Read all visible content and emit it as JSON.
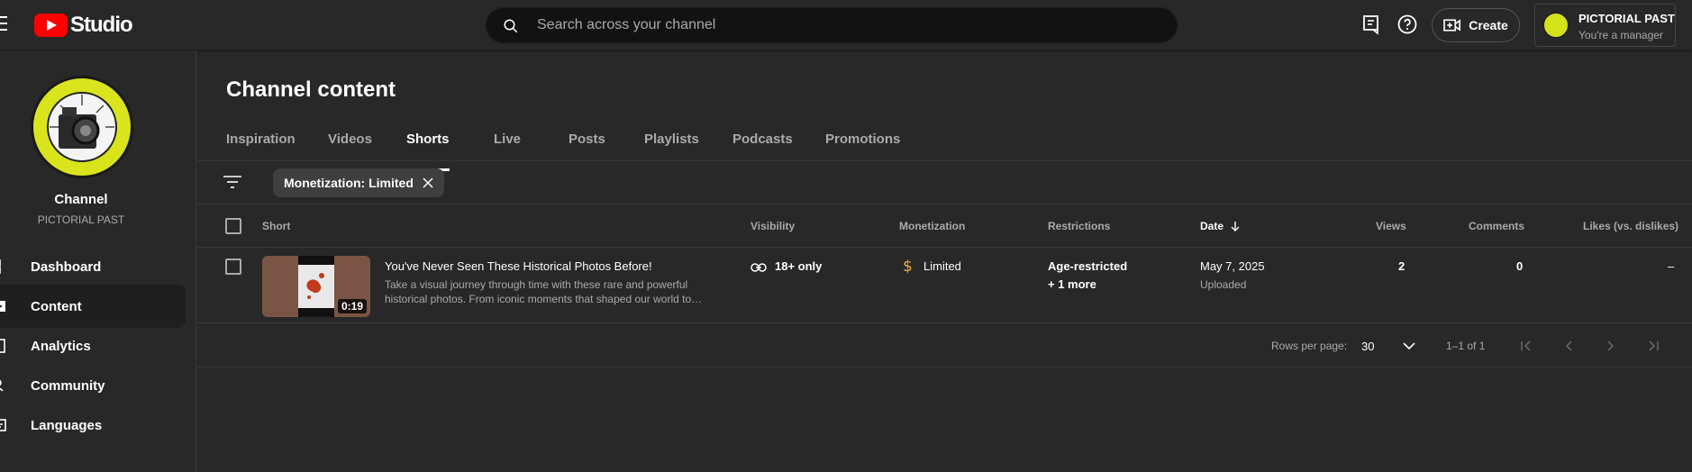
{
  "header": {
    "logo_text": "Studio",
    "search_placeholder": "Search across your channel",
    "create_label": "Create",
    "account_name": "PICTORIAL PAST",
    "account_role": "You're a manager"
  },
  "sidebar": {
    "channel_label": "Channel",
    "channel_name": "PICTORIAL PAST",
    "items": [
      {
        "label": "Dashboard",
        "icon": "dashboard-icon"
      },
      {
        "label": "Content",
        "icon": "content-icon"
      },
      {
        "label": "Analytics",
        "icon": "analytics-icon"
      },
      {
        "label": "Community",
        "icon": "community-icon"
      },
      {
        "label": "Languages",
        "icon": "languages-icon"
      }
    ]
  },
  "main": {
    "title": "Channel content",
    "tabs": [
      "Inspiration",
      "Videos",
      "Shorts",
      "Live",
      "Posts",
      "Playlists",
      "Podcasts",
      "Promotions"
    ],
    "active_tab": "Shorts",
    "filter_chip": "Monetization: Limited",
    "columns": {
      "short": "Short",
      "visibility": "Visibility",
      "monetization": "Monetization",
      "restrictions": "Restrictions",
      "date": "Date",
      "views": "Views",
      "comments": "Comments",
      "likes": "Likes (vs. dislikes)"
    },
    "row": {
      "duration": "0:19",
      "title": "You've Never Seen These Historical Photos Before!",
      "description": "Take a visual journey through time with these rare and powerful historical photos. From iconic moments that shaped our world to…",
      "visibility": "18+ only",
      "monetization": "Limited",
      "restrictions": "Age-restricted",
      "restrictions_more": "+ 1 more",
      "date": "May 7, 2025",
      "date_status": "Uploaded",
      "views": "2",
      "comments": "0",
      "likes": "–"
    },
    "pagination": {
      "rows_label": "Rows per page:",
      "rows_value": "30",
      "range": "1–1 of 1"
    }
  },
  "colors": {
    "accent_red": "#ff0000",
    "monetization_limited": "#f2a93b",
    "avatar_yellow": "#d9e41c"
  }
}
